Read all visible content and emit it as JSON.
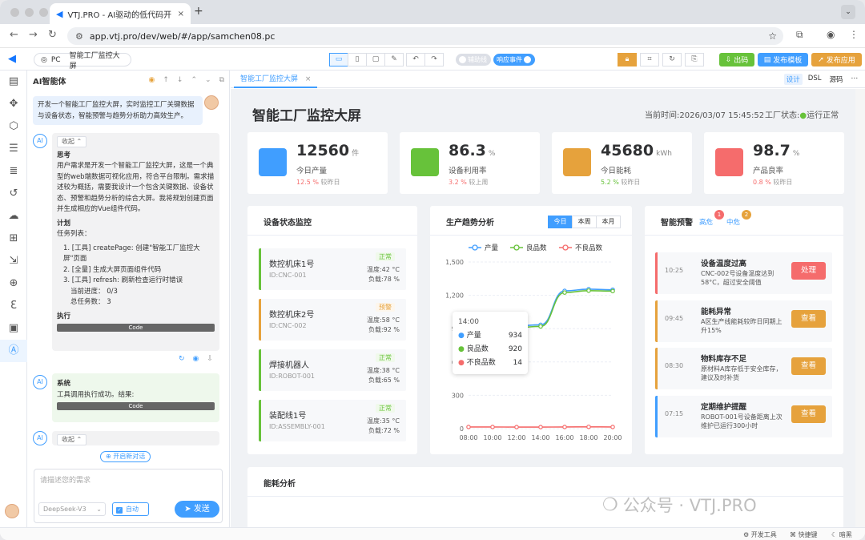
{
  "browser": {
    "tab_title": "VTJ.PRO - AI驱动的低代码开发",
    "tab_close": "×",
    "new_tab": "+",
    "url": "app.vtj.pro/dev/web/#/app/samchen08.pc"
  },
  "toolbar": {
    "platform": "PC",
    "page_name": "智能工厂监控大屏",
    "assist_line": "辅助线",
    "respond_event": "响应事件",
    "publish_btn": "出码",
    "template_btn": "发布模板",
    "app_btn": "发布应用"
  },
  "ai": {
    "title": "AI智能体",
    "user_msg": "开发一个智能工厂监控大屏，实时监控工厂关键数据与设备状态，智能预警与趋势分析助力高效生产。",
    "fold_label": "收起 ⌃",
    "think_title": "思考",
    "think_text": "用户需求是开发一个智能工厂监控大屏，这是一个典型的web端数据可视化应用，符合平台限制。需求描述较为概括，需要我设计一个包含关键数据、设备状态、预警和趋势分析的综合大屏。我将规划创建页面并生成相应的Vue组件代码。",
    "plan_title": "计划",
    "task_list_label": "任务列表：",
    "tasks": [
      "1. [工具] createPage: 创建\"智能工厂监控大屏\"页面",
      "2. [全量] 生成大屏页面组件代码",
      "3. [工具] refresh: 刷新检查运行时错误"
    ],
    "progress": "当前进度： 0/3",
    "total": "总任务数： 3",
    "exec_title": "执行",
    "code_label": "Code",
    "sys_title": "系统",
    "sys_text": "工具调用执行成功。结果:",
    "new_chat": "开启新对话",
    "input_placeholder": "请描述您的需求",
    "model": "DeepSeek-V3",
    "auto": "自动",
    "send": "发送"
  },
  "editor": {
    "tab": "智能工厂监控大屏",
    "modes": [
      "设计",
      "DSL",
      "源码"
    ]
  },
  "dashboard": {
    "title": "智能工厂监控大屏",
    "time": "当前时间:2026/03/07 15:45:52",
    "status_label": "工厂状态:",
    "status_value": "运行正常",
    "kpis": [
      {
        "value": "12560",
        "unit": "件",
        "label": "今日产量",
        "change": "12.5 %",
        "cmp": "较昨日",
        "color": "#409eff",
        "change_color": "#f56c6c"
      },
      {
        "value": "86.3",
        "unit": "%",
        "label": "设备利用率",
        "change": "3.2 %",
        "cmp": "较上周",
        "color": "#67c23a",
        "change_color": "#f56c6c"
      },
      {
        "value": "45680",
        "unit": "kWh",
        "label": "今日能耗",
        "change": "5.2 %",
        "cmp": "较昨日",
        "color": "#e6a23c",
        "change_color": "#67c23a"
      },
      {
        "value": "98.7",
        "unit": "%",
        "label": "产品良率",
        "change": "0.8 %",
        "cmp": "较昨日",
        "color": "#f56c6c",
        "change_color": "#f56c6c"
      }
    ],
    "devices_title": "设备状态监控",
    "devices": [
      {
        "name": "数控机床1号",
        "id": "ID:CNC-001",
        "status": "正常",
        "temp": "温度:42 °C",
        "load": "负载:78 %"
      },
      {
        "name": "数控机床2号",
        "id": "ID:CNC-002",
        "status": "预警",
        "temp": "温度:58 °C",
        "load": "负载:92 %"
      },
      {
        "name": "焊接机器人",
        "id": "ID:ROBOT-001",
        "status": "正常",
        "temp": "温度:38 °C",
        "load": "负载:65 %"
      },
      {
        "name": "装配线1号",
        "id": "ID:ASSEMBLY-001",
        "status": "正常",
        "temp": "温度:35 °C",
        "load": "负载:72 %"
      }
    ],
    "trend_title": "生产趋势分析",
    "ranges": [
      "今日",
      "本周",
      "本月"
    ],
    "alerts_title": "智能预警",
    "alert_high": "高危",
    "alert_high_count": "1",
    "alert_mid": "中危",
    "alert_mid_count": "2",
    "alerts": [
      {
        "time": "10:25",
        "title": "设备温度过高",
        "desc": "CNC-002号设备温度达到58°C，超过安全阈值",
        "btn": "处理",
        "color": "#f56c6c"
      },
      {
        "time": "09:45",
        "title": "能耗异常",
        "desc": "A区生产线能耗较昨日同期上升15%",
        "btn": "查看",
        "color": "#e6a23c"
      },
      {
        "time": "08:30",
        "title": "物料库存不足",
        "desc": "原材料A库存低于安全库存，建议及时补货",
        "btn": "查看",
        "color": "#e6a23c"
      },
      {
        "time": "07:15",
        "title": "定期维护提醒",
        "desc": "ROBOT-001号设备距离上次维护已运行300小时",
        "btn": "查看",
        "color": "#409eff"
      }
    ],
    "energy_title": "能耗分析"
  },
  "chart_data": {
    "type": "line",
    "x": [
      "08:00",
      "10:00",
      "12:00",
      "14:00",
      "16:00",
      "18:00",
      "20:00"
    ],
    "series": [
      {
        "name": "产量",
        "color": "#409eff",
        "values": [
          900,
          915,
          925,
          934,
          1240,
          1255,
          1250
        ]
      },
      {
        "name": "良品数",
        "color": "#67c23a",
        "values": [
          885,
          898,
          910,
          920,
          1225,
          1242,
          1238
        ]
      },
      {
        "name": "不良品数",
        "color": "#f56c6c",
        "values": [
          15,
          15,
          14,
          14,
          15,
          16,
          15
        ]
      }
    ],
    "yticks": [
      "1,500",
      "1,200",
      "900",
      "600",
      "300",
      "0"
    ],
    "ylim": [
      0,
      1500
    ],
    "tooltip": {
      "title": "14:00",
      "rows": [
        {
          "name": "产量",
          "value": "934"
        },
        {
          "name": "良品数",
          "value": "920"
        },
        {
          "name": "不良品数",
          "value": "14"
        }
      ]
    }
  },
  "statusbar": {
    "dev_tools": "开发工具",
    "shortcuts": "快捷键",
    "dark": "暗黑"
  },
  "watermark": "公众号 · VTJ.PRO"
}
